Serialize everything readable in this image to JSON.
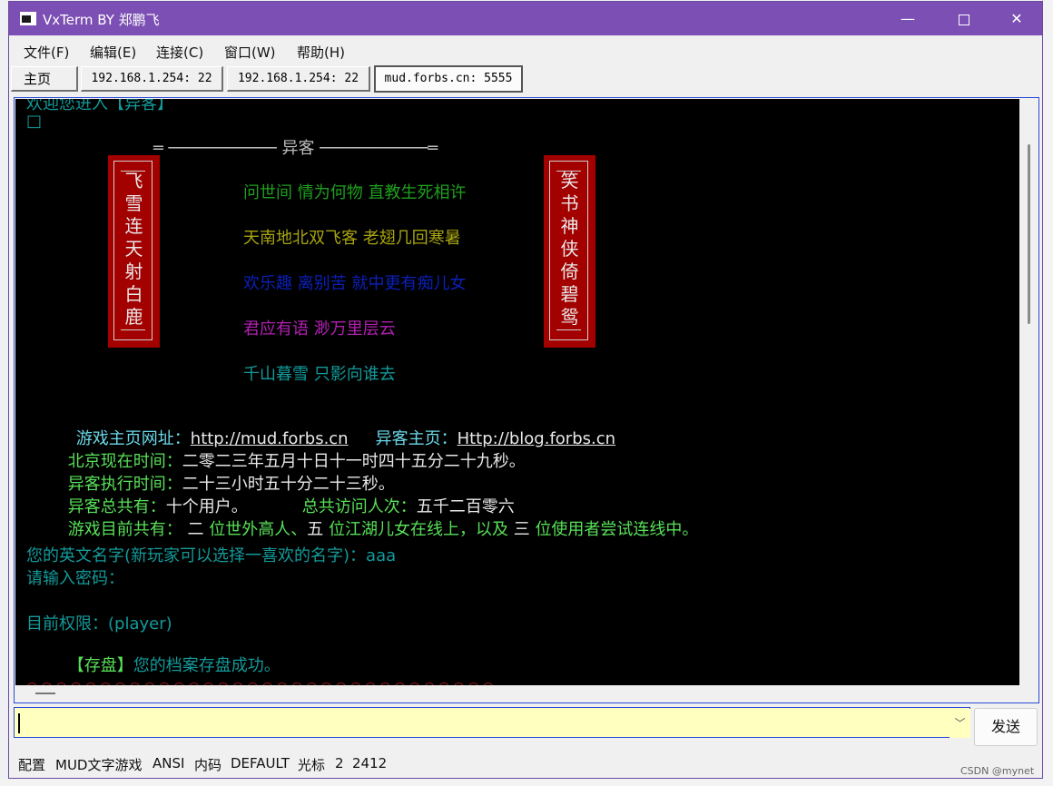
{
  "window": {
    "title": "VxTerm BY 郑鹏飞",
    "controls": {
      "minimize": "—",
      "maximize": "",
      "close": "✕"
    }
  },
  "menu": [
    "文件(F)",
    "编辑(E)",
    "连接(C)",
    "窗口(W)",
    "帮助(H)"
  ],
  "tabs": [
    "主页",
    "192.168.1.254: 22",
    "192.168.1.254: 22",
    "mud.forbs.cn: 5555"
  ],
  "active_tab": 3,
  "terminal": {
    "top_partial": "欢迎您进入【异客】",
    "box_char": "□",
    "header": "═ ─────────── 异客 ───────────═",
    "left_banner": [
      "飞",
      "雪",
      "连",
      "天",
      "射",
      "白",
      "鹿"
    ],
    "right_banner": [
      "笑",
      "书",
      "神",
      "侠",
      "倚",
      "碧",
      "鸳"
    ],
    "poem": [
      "问世间 情为何物 直教生死相许",
      "天南地北双飞客 老翅几回寒暑",
      "欢乐趣 离别苦 就中更有痴儿女",
      "君应有语 渺万里层云",
      "千山暮雪 只影向谁去"
    ],
    "homepage_label": "游戏主页网址：",
    "homepage_url": "http://mud.forbs.cn",
    "blog_label": "异客主页：",
    "blog_url": "Http://blog.forbs.cn",
    "beijing_label": "北京现在时间：",
    "beijing_value": "二零二三年五月十日十一时四十五分二十九秒。",
    "exec_label": "异客执行时间：",
    "exec_value": "二十三小时五十分二十三秒。",
    "users_label": "异客总共有：",
    "users_value": "十个用户。",
    "visits_label": "总共访问人次：",
    "visits_value": "五千二百零六",
    "online_label": "游戏目前共有：",
    "online_n1": " 二 ",
    "online_t1": "位世外高人、",
    "online_n2": "五 ",
    "online_t2": "位江湖儿女在线上，以及 ",
    "online_n3": "三 ",
    "online_t3": "位使用者尝试连线中。",
    "name_prompt": "您的英文名字(新玩家可以选择一喜欢的名字)：aaa",
    "password_prompt": "请输入密码：",
    "permission": "目前权限：(player)",
    "save_tag": "【存盘】",
    "save_msg": "您的档案存盘成功。",
    "bottom_dots": "○○○○○○○○○○○○○○○○○○○○○○○○○○○○○○○○"
  },
  "input": {
    "value": "",
    "send_label": "发送"
  },
  "status": [
    "配置",
    "MUD文字游戏",
    "ANSI",
    "内码",
    "DEFAULT",
    "光标",
    "2",
    "2412"
  ],
  "watermark": "CSDN @mynet",
  "colors": {
    "titlebar": "#7b4fb3",
    "terminal_bg": "#000000",
    "input_bg": "#ffffc0",
    "banner_red": "#a30000"
  }
}
